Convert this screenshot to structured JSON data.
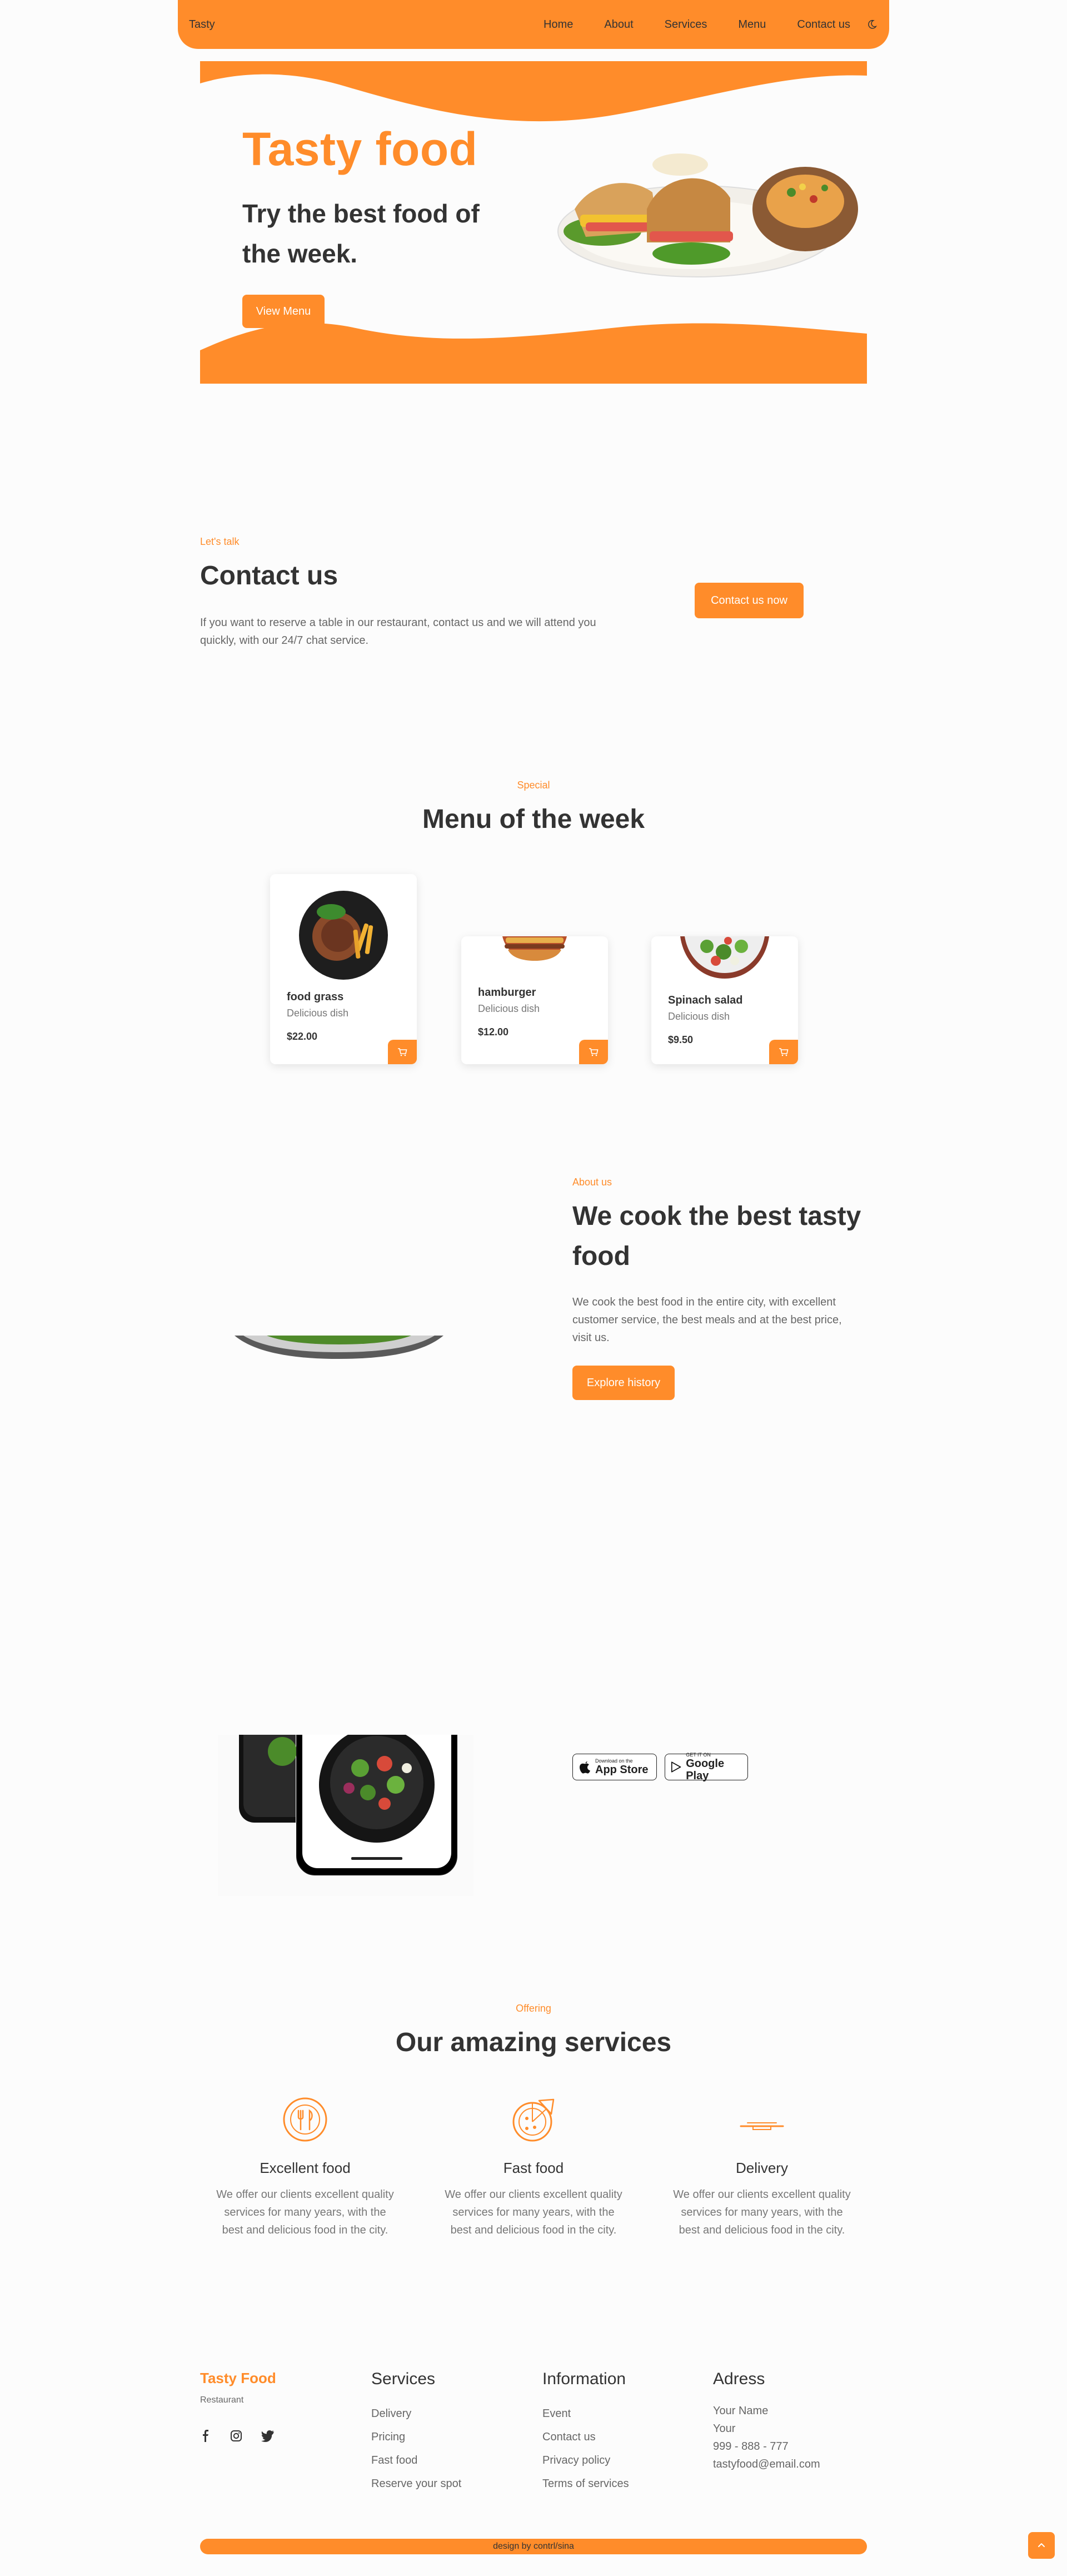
{
  "nav": {
    "logo": "Tasty",
    "links": [
      "Home",
      "About",
      "Services",
      "Menu",
      "Contact us"
    ],
    "theme_icon": "moon-icon"
  },
  "hero": {
    "title": "Tasty food",
    "subtitle": "Try the best food of the week.",
    "button": "View Menu"
  },
  "contact": {
    "kicker": "Let's talk",
    "title": "Contact us",
    "text": "If you want to reserve a table in our restaurant, contact us and we will attend you quickly, with our 24/7 chat service.",
    "button": "Contact us now"
  },
  "menu": {
    "kicker": "Special",
    "title": "Menu of the week",
    "items": [
      {
        "name": "food grass",
        "desc": "Delicious dish",
        "price": "$22.00"
      },
      {
        "name": "hamburger",
        "desc": "Delicious dish",
        "price": "$12.00"
      },
      {
        "name": "Spinach salad",
        "desc": "Delicious dish",
        "price": "$9.50"
      }
    ],
    "cart_icon": "cart-icon"
  },
  "about": {
    "kicker": "About us",
    "title": "We cook the best tasty food",
    "text": "We cook the best food in the entire city, with excellent customer service, the best meals and at the best price, visit us.",
    "button": "Explore history"
  },
  "app": {
    "appstore_small": "Download on the",
    "appstore_big": "App Store",
    "googleplay_small": "GET IT ON",
    "googleplay_big": "Google Play"
  },
  "services": {
    "kicker": "Offering",
    "title": "Our amazing services",
    "items": [
      {
        "name": "Excellent food",
        "text": "We offer our clients excellent quality services for many years, with the best and delicious food in the city.",
        "icon": "utensils-icon"
      },
      {
        "name": "Fast food",
        "text": "We offer our clients excellent quality services for many years, with the best and delicious food in the city.",
        "icon": "pizza-icon"
      },
      {
        "name": "Delivery",
        "text": "We offer our clients excellent quality services for many years, with the best and delicious food in the city.",
        "icon": "delivery-icon"
      }
    ]
  },
  "footer": {
    "brand": "Tasty Food",
    "tagline": "Restaurant",
    "social": [
      "facebook-icon",
      "instagram-icon",
      "twitter-icon"
    ],
    "services_head": "Services",
    "services": [
      "Delivery",
      "Pricing",
      "Fast food",
      "Reserve your spot"
    ],
    "info_head": "Information",
    "info": [
      "Event",
      "Contact us",
      "Privacy policy",
      "Terms of services"
    ],
    "address_head": "Adress",
    "address": [
      "Your Name",
      "Your",
      "999 - 888 - 777",
      "tastyfood@email.com"
    ],
    "copyright": "design by contrl/sina"
  },
  "colors": {
    "accent": "#ff8c2a",
    "text": "#333333",
    "muted": "#777777",
    "background": "#fcfcfc"
  }
}
